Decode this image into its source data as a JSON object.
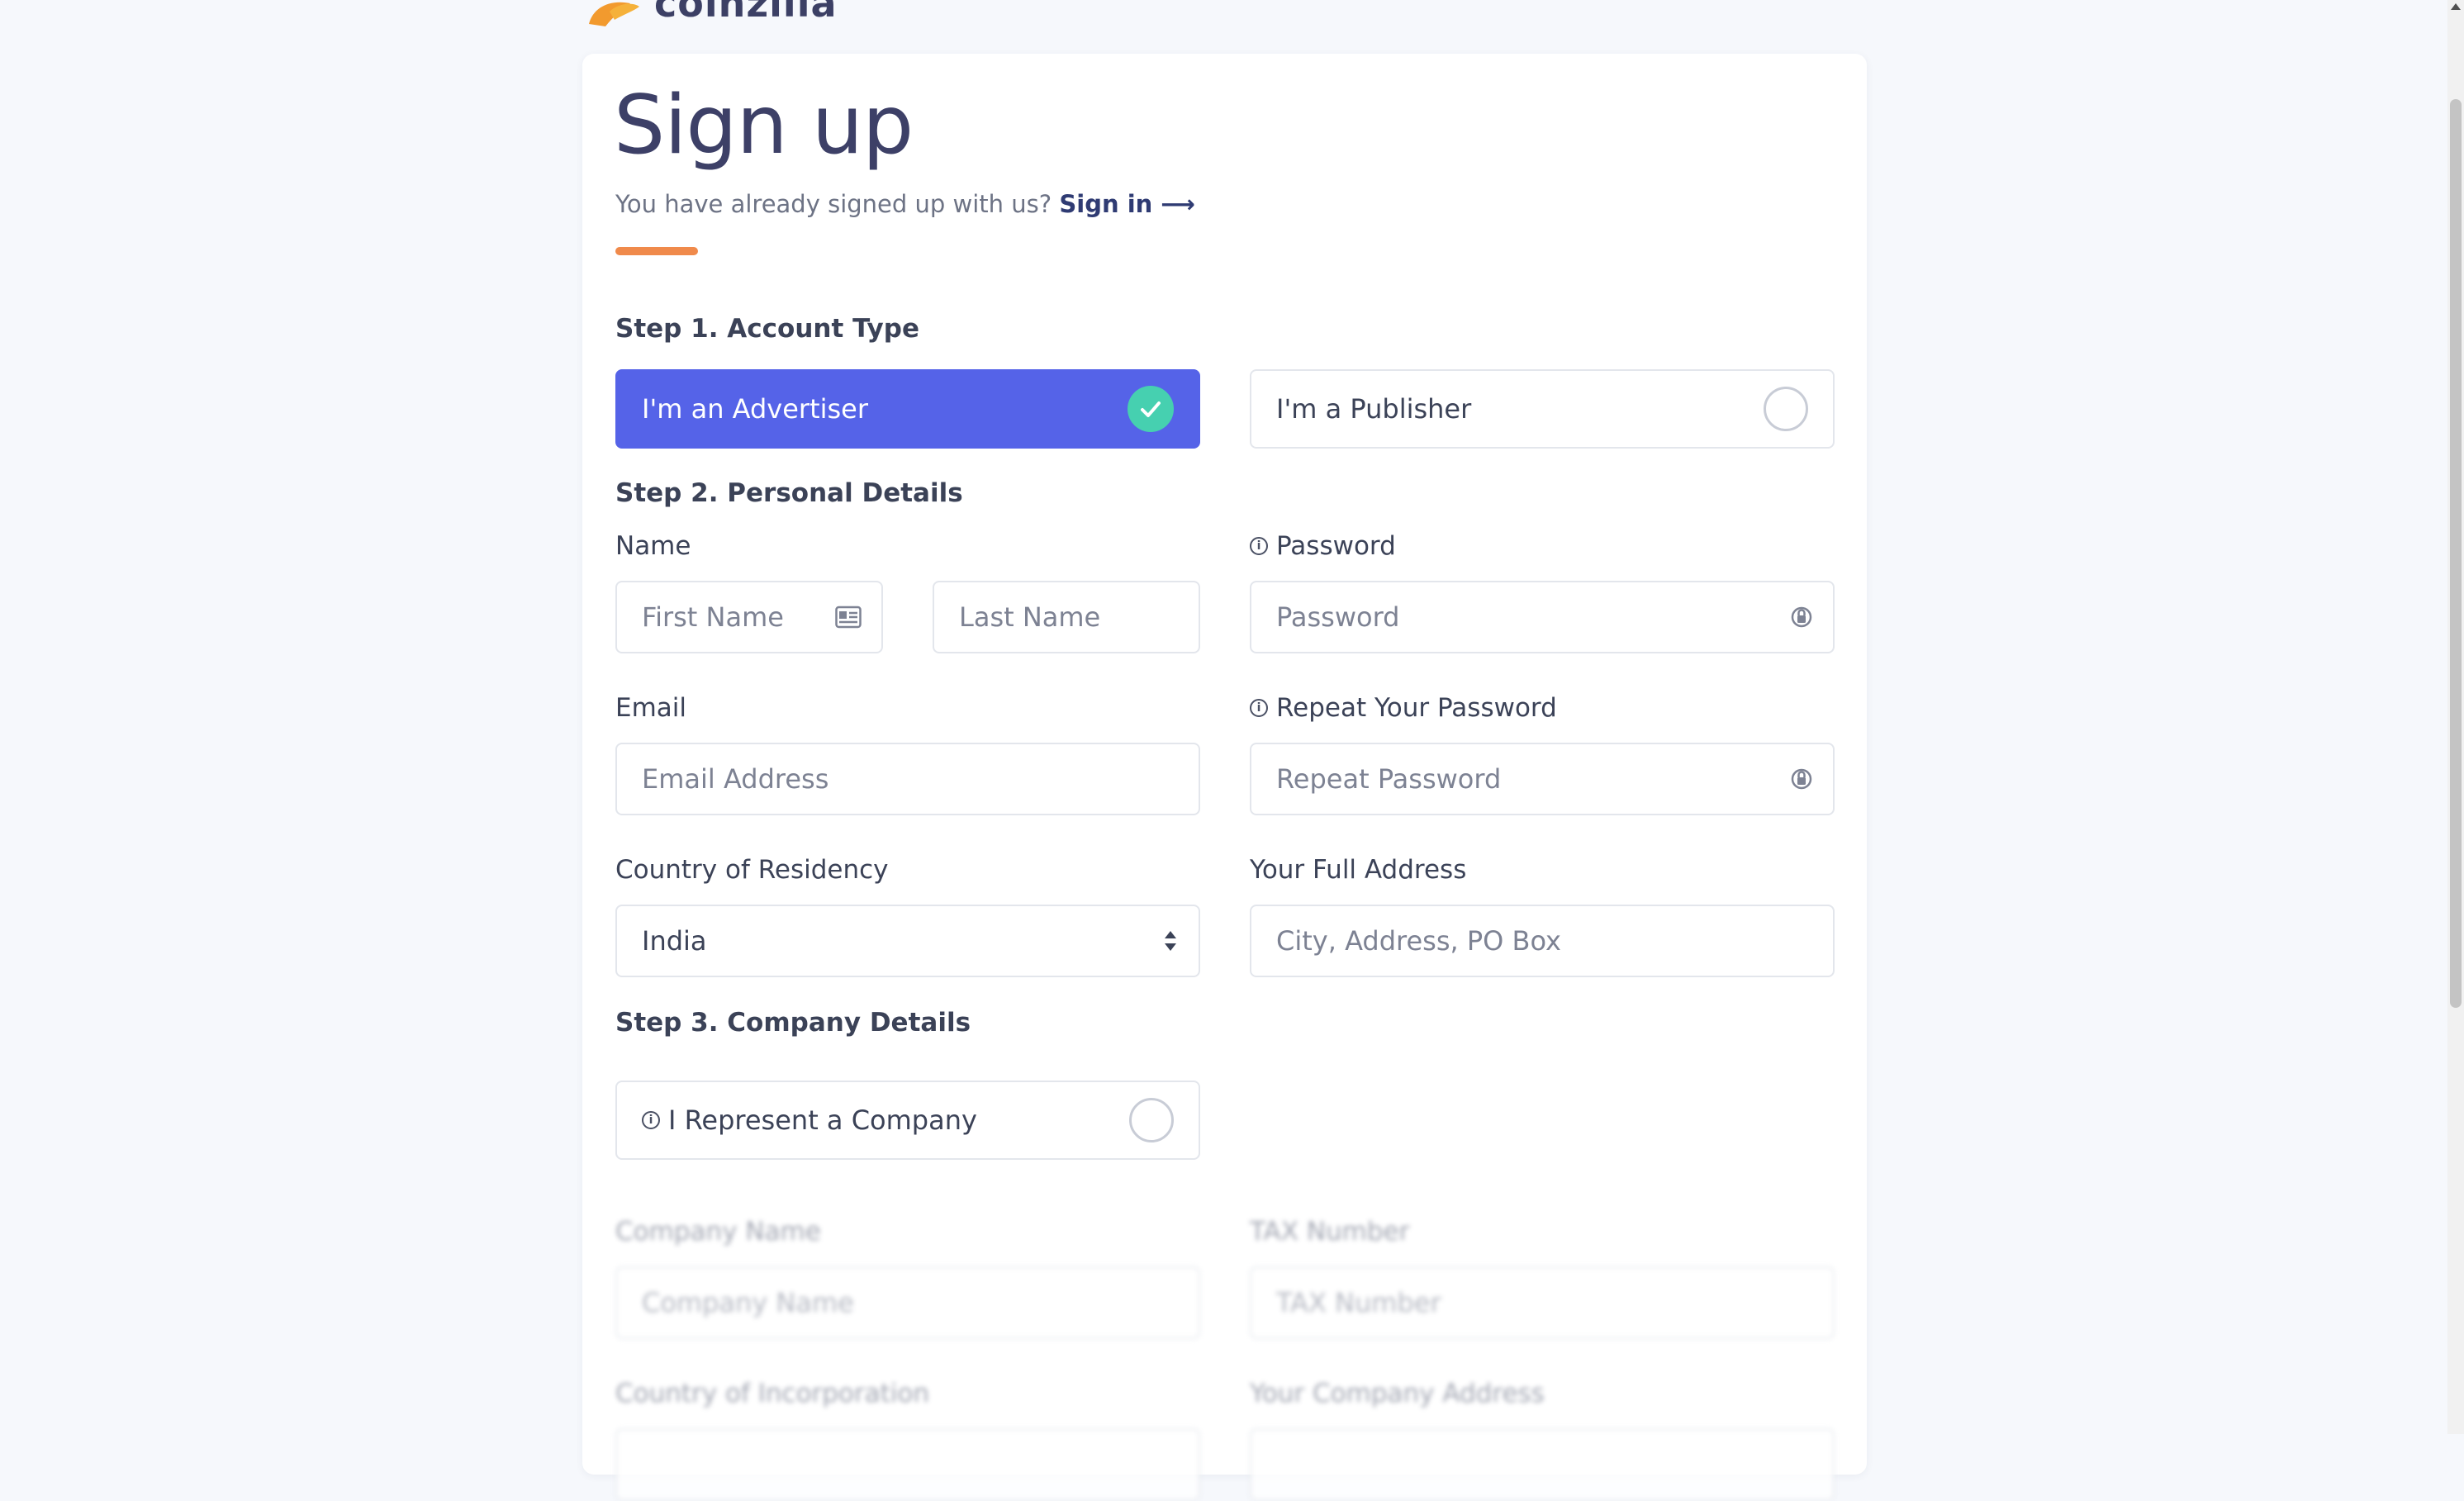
{
  "brand": {
    "name": "coinzilla"
  },
  "header": {
    "title": "Sign up",
    "subtitle": "You have already signed up with us?",
    "signin_link": "Sign in ⟶"
  },
  "step1": {
    "title": "Step 1. Account Type",
    "advertiser_label": "I'm an Advertiser",
    "publisher_label": "I'm a Publisher",
    "selected": "advertiser"
  },
  "step2": {
    "title": "Step 2. Personal Details",
    "name_label": "Name",
    "first_name_placeholder": "First Name",
    "last_name_placeholder": "Last Name",
    "password_label": "Password",
    "password_placeholder": "Password",
    "email_label": "Email",
    "email_placeholder": "Email Address",
    "repeat_password_label": "Repeat Your Password",
    "repeat_password_placeholder": "Repeat Password",
    "country_label": "Country of Residency",
    "country_value": "India",
    "address_label": "Your Full Address",
    "address_placeholder": "City, Address, PO Box"
  },
  "step3": {
    "title": "Step 3. Company Details",
    "represent_company_label": "I Represent a Company",
    "company_name_label": "Company Name",
    "company_name_placeholder": "Company Name",
    "tax_number_label": "TAX Number",
    "tax_number_placeholder": "TAX Number",
    "country_incorporation_label": "Country of Incorporation",
    "company_address_label": "Your Company Address"
  },
  "colors": {
    "accent": "#5563e8",
    "check": "#46d0b0",
    "orange": "#f08a4b"
  }
}
